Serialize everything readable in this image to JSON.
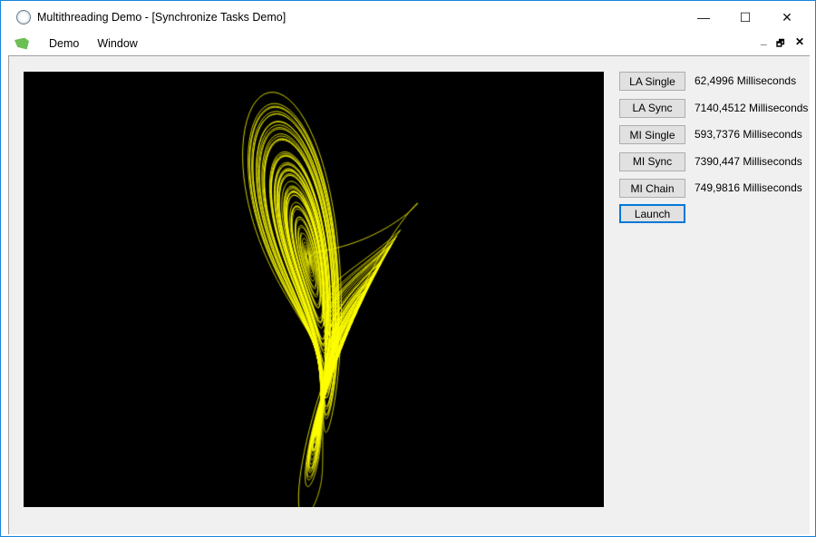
{
  "window": {
    "title": "Multithreading Demo - [Synchronize Tasks Demo]",
    "icon": "clock-icon"
  },
  "controls": {
    "minimize": "—",
    "maximize": "☐",
    "close": "✕"
  },
  "menu": {
    "items": [
      {
        "label": "Demo"
      },
      {
        "label": "Window"
      }
    ],
    "mdi_minimize": "_",
    "mdi_restore": "🗗",
    "mdi_close": "✕"
  },
  "canvas": {
    "content": "Lorenz attractor",
    "line_color": "#ffff00",
    "background": "#000000"
  },
  "buttons": [
    {
      "label": "LA Single",
      "result": "62,4996 Milliseconds"
    },
    {
      "label": "LA Sync",
      "result": "7140,4512 Milliseconds"
    },
    {
      "label": "MI Single",
      "result": "593,7376 Milliseconds"
    },
    {
      "label": "MI Sync",
      "result": "7390,447 Milliseconds"
    },
    {
      "label": "MI Chain",
      "result": "749,9816 Milliseconds"
    }
  ],
  "launch": {
    "label": "Launch"
  }
}
